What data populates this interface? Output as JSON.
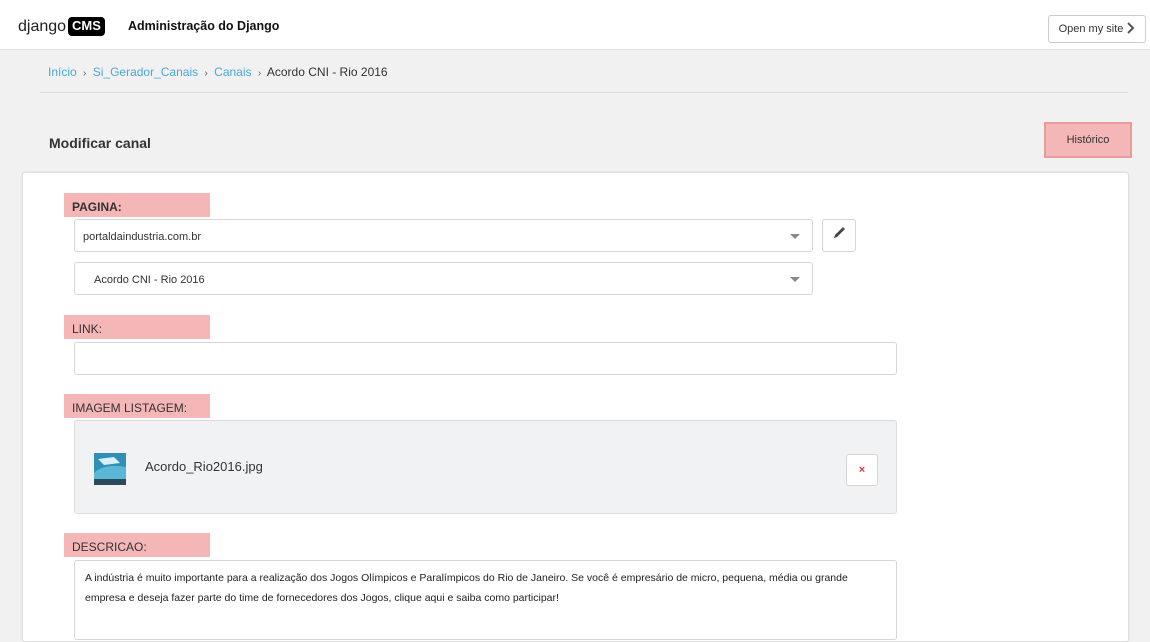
{
  "header": {
    "logo_text": "django",
    "logo_badge": "CMS",
    "site_title": "Administração do Django",
    "open_site_label": "Open my site"
  },
  "breadcrumb": {
    "items": [
      "Início",
      "Si_Gerador_Canais",
      "Canais"
    ],
    "current": "Acordo CNI - Rio 2016",
    "separator": "›"
  },
  "page": {
    "title": "Modificar canal",
    "history_label": "Histórico"
  },
  "form": {
    "pagina": {
      "label": "PAGINA:",
      "site_value": "portaldaindustria.com.br",
      "page_value": "Acordo CNI - Rio 2016"
    },
    "link": {
      "label": "LINK:",
      "value": ""
    },
    "imagem": {
      "label": "IMAGEM LISTAGEM:",
      "file_name": "Acordo_Rio2016.jpg",
      "remove_symbol": "×"
    },
    "descricao": {
      "label": "DESCRICAO:",
      "value": "A indústria é muito importante para a realização dos Jogos Olímpicos e Paralímpicos do Rio de Janeiro. Se você é empresário de micro, pequena, média ou grande empresa e deseja fazer parte do time de fornecedores dos Jogos, clique aqui e saiba como participar!"
    }
  },
  "colors": {
    "highlight": "#f4b6b6",
    "link": "#48a9d8",
    "remove": "#e03a3a"
  }
}
